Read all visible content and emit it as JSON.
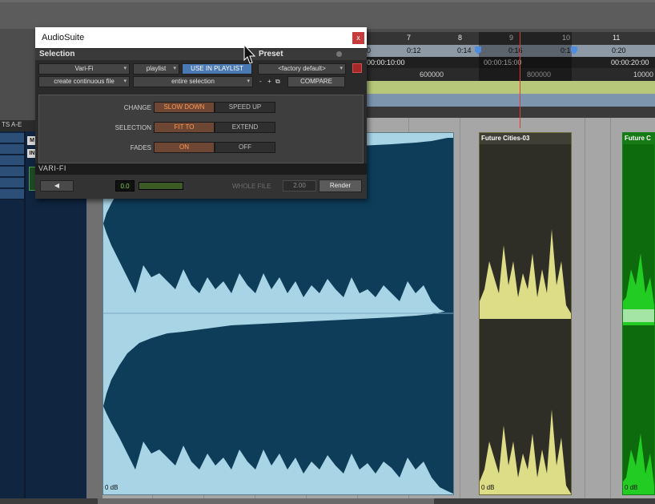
{
  "rulers": {
    "bars": [
      "7",
      "8",
      "9",
      "10",
      "11"
    ],
    "min_secs": [
      "0",
      "0:12",
      "0:14",
      "0:16",
      "0:1",
      "0:20"
    ],
    "timecode": [
      "00:00:10:00",
      "00:00:15:00",
      "00:00:20:00"
    ],
    "samples": [
      "600000",
      "800000",
      "10000"
    ]
  },
  "left_panel": {
    "header": "TS A-E",
    "buttons": [
      "M",
      "IN"
    ]
  },
  "clips": [
    {
      "name": "",
      "gain": "0 dB",
      "color": "#a8d4e6",
      "wave_color": "#0e3d5a"
    },
    {
      "name": "Future Cities-03",
      "gain": "0 dB",
      "color": "#dddd88",
      "wave_color": "#2e2e26"
    },
    {
      "name": "Future C",
      "gain": "0 dB",
      "color": "#22cc22",
      "wave_color": "#0d6b0d"
    }
  ],
  "audiosuite": {
    "title": "AudioSuite",
    "close": "x",
    "selection_header": "Selection",
    "preset_header": "Preset",
    "plugin_select": "Vari-Fi",
    "target_select": "playlist",
    "use_in_playlist": "USE IN PLAYLIST",
    "preset_select": "<factory default>",
    "process_mode": "create continuous file",
    "selection_mode": "entire selection",
    "preset_minus": "-",
    "preset_plus": "+",
    "compare": "COMPARE",
    "rows": {
      "change": {
        "label": "CHANGE",
        "opt1": "SLOW DOWN",
        "opt2": "SPEED UP",
        "selected": "opt1"
      },
      "selection": {
        "label": "SELECTION",
        "opt1": "FIT TO",
        "opt2": "EXTEND",
        "selected": "opt1"
      },
      "fades": {
        "label": "FADES",
        "opt1": "ON",
        "opt2": "OFF",
        "selected": "opt1"
      }
    },
    "plugin_label": "VARI-FI",
    "preview_icon": "speaker-icon",
    "bypass_value": "0.0",
    "whole_file": "WHOLE FILE",
    "handle_value": "2.00",
    "render": "Render"
  },
  "colors": {
    "accent_on": "#ff9a52",
    "use_in_playlist": "#4a79b4",
    "playhead": "#e23a3a",
    "close_button": "#c63b3b"
  }
}
